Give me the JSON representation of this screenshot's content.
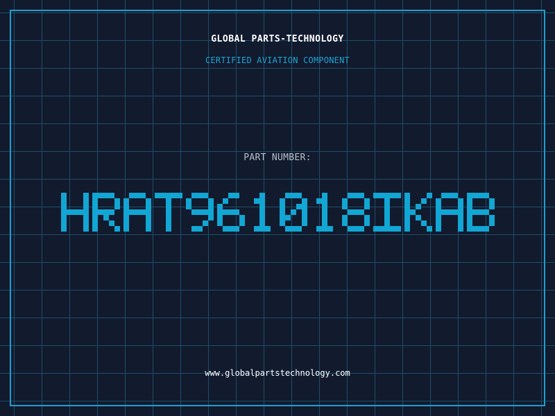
{
  "header": {
    "company": "GLOBAL PARTS-TECHNOLOGY",
    "subtitle": "CERTIFIED AVIATION COMPONENT"
  },
  "part": {
    "label": "PART NUMBER:",
    "number": "HRAT961018IKAB"
  },
  "footer": {
    "website": "www.globalpartstechnology.com"
  },
  "colors": {
    "background": "#121a2e",
    "grid": "#1d4f67",
    "frame": "#1f9fcc",
    "accent": "#1fa4d4",
    "part_number": "#12a6d4"
  }
}
